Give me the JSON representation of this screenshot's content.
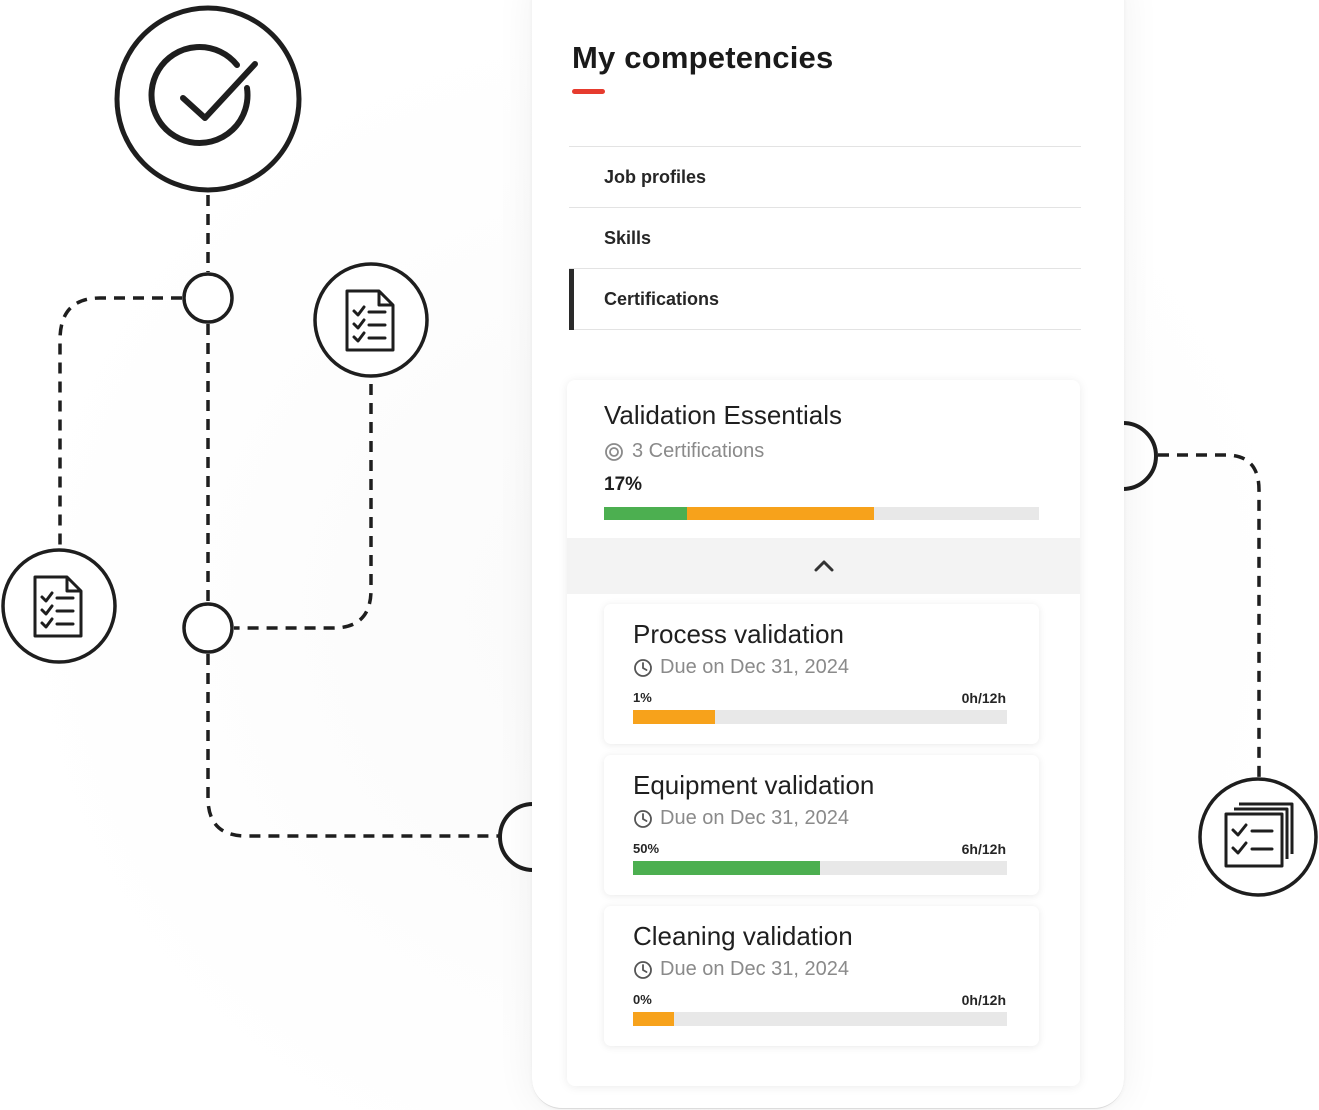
{
  "colors": {
    "accent_red": "#e63b2e",
    "progress_green": "#4caf50",
    "progress_orange": "#f7a21b",
    "track_gray": "#e8e8e8",
    "active_marker": "#2a2a2a"
  },
  "page": {
    "title": "My competencies"
  },
  "nav": {
    "items": [
      {
        "label": "Job profiles",
        "active": false
      },
      {
        "label": "Skills",
        "active": false
      },
      {
        "label": "Certifications",
        "active": true
      }
    ]
  },
  "course": {
    "title": "Validation Essentials",
    "meta_icon": "certificate-icon",
    "meta": "3 Certifications",
    "percent_label": "17%",
    "progress_segments": [
      {
        "status": "completed",
        "fraction": 0.19,
        "color": "#4caf50"
      },
      {
        "status": "in-progress",
        "fraction": 0.43,
        "color": "#f7a21b"
      }
    ],
    "collapse_icon": "chevron-up-icon"
  },
  "certifications": [
    {
      "title": "Process validation",
      "due_icon": "clock-icon",
      "due": "Due on Dec 31, 2024",
      "percent_label": "1%",
      "hours": "0h/12h",
      "bar_fraction": 0.22,
      "bar_color": "#f7a21b"
    },
    {
      "title": "Equipment validation",
      "due_icon": "clock-icon",
      "due": "Due on Dec 31, 2024",
      "percent_label": "50%",
      "hours": "6h/12h",
      "bar_fraction": 0.5,
      "bar_color": "#4caf50"
    },
    {
      "title": "Cleaning validation",
      "due_icon": "clock-icon",
      "due": "Due on Dec 31, 2024",
      "percent_label": "0%",
      "hours": "0h/12h",
      "bar_fraction": 0.11,
      "bar_color": "#f7a21b"
    }
  ],
  "decor_icons": [
    "checkmark-circle-icon",
    "checklist-document-icon",
    "checklist-document-icon",
    "checklist-stack-icon"
  ]
}
